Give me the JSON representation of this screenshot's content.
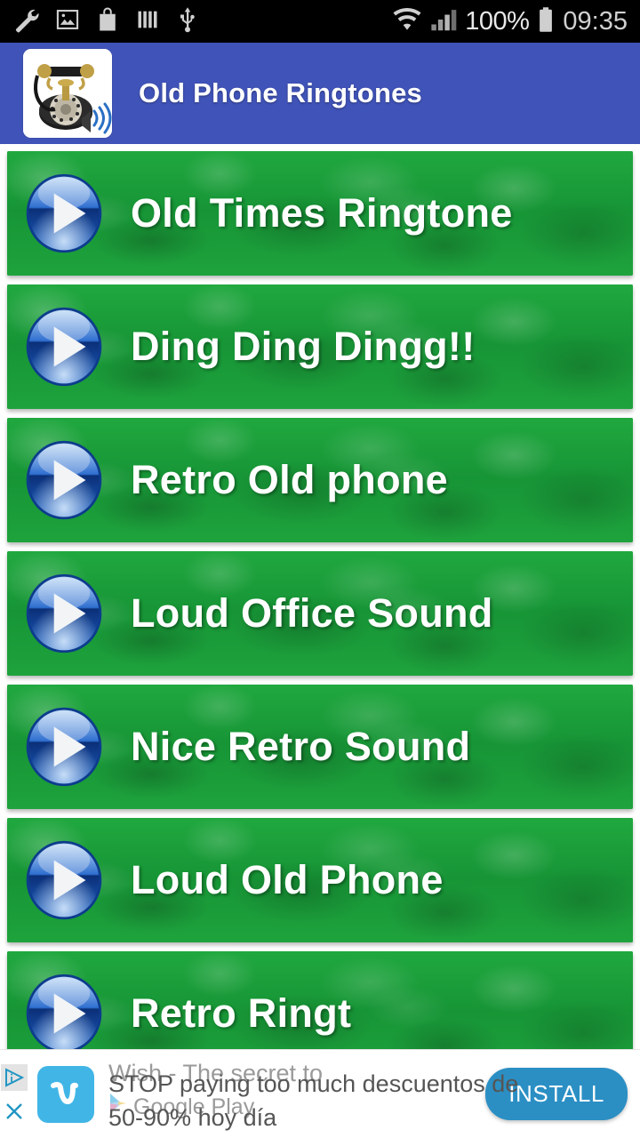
{
  "status_bar": {
    "left_icons": [
      "wrench-icon",
      "photo-icon",
      "shopping-bag-icon",
      "bars-icon",
      "usb-icon"
    ],
    "wifi_icon": "wifi-icon",
    "signal_icon": "cellular-signal-icon",
    "battery_percent": "100%",
    "battery_icon": "battery-full-icon",
    "clock": "09:35",
    "background_color": "#000000",
    "text_color": "#e0e0e0"
  },
  "app_bar": {
    "title": "Old Phone Ringtones",
    "icon": "antique-phone-icon",
    "background_color": "#4053b8",
    "title_color": "#ffffff"
  },
  "list": {
    "row_background_color": "#18a038",
    "row_text_color": "#ffffff",
    "play_icon": "play-button-icon",
    "items": [
      {
        "label": "Old Times Ringtone"
      },
      {
        "label": "Ding Ding Dingg!!"
      },
      {
        "label": "Retro Old phone"
      },
      {
        "label": "Loud Office Sound"
      },
      {
        "label": "Nice Retro Sound"
      },
      {
        "label": "Loud Old Phone"
      },
      {
        "label": "Retro Ringt"
      }
    ]
  },
  "ad_banner": {
    "adchoices_icon": "adchoices-icon",
    "close_icon": "close-icon",
    "advertiser_icon": "wish-logo-icon",
    "headline_back_line1": "Wish - The secret to",
    "headline_back_line2": "Google Play",
    "store_icon": "google-play-icon",
    "headline_front_line1": "STOP paying too much descuentos de",
    "headline_front_line2": "50-90% hoy día",
    "cta_label": "INSTALL",
    "cta_color": "#2b8fc4",
    "background_color": "#ffffff"
  }
}
